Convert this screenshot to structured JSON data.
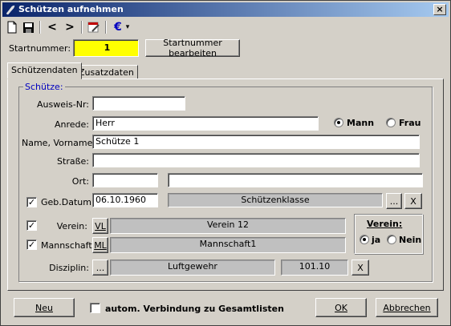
{
  "window": {
    "title": "Schützen aufnehmen",
    "close_label": "×"
  },
  "toolbar": {
    "prev_label": "<",
    "next_label": ">",
    "euro_label": "€",
    "dropdown_label": "▾"
  },
  "startnummer": {
    "label": "Startnummer:",
    "value": "1",
    "edit_button": "Startnummer bearbeiten",
    "highlight_color": "#ffff00"
  },
  "tabs": [
    {
      "label": "Schützendaten"
    },
    {
      "label": "Zusatzdaten"
    }
  ],
  "group": {
    "title": "Schütze:"
  },
  "fields": {
    "ausweis": {
      "label": "Ausweis-Nr:",
      "value": ""
    },
    "anrede": {
      "label": "Anrede:",
      "value": "Herr"
    },
    "gender": {
      "mann": "Mann",
      "frau": "Frau",
      "selected": "Mann"
    },
    "name": {
      "label": "Name, Vorname:",
      "value": "Schütze  1"
    },
    "strasse": {
      "label": "Straße:",
      "value": ""
    },
    "ort": {
      "label": "Ort:",
      "plz": "",
      "city": ""
    },
    "geb": {
      "label": "Geb.Datum:",
      "value": "06.10.1960",
      "checked": true,
      "klasse": "Schützenklasse",
      "dots": "...",
      "x": "X"
    },
    "verein": {
      "label": "Verein:",
      "checked": true,
      "button": "VL",
      "value": "Verein 12"
    },
    "mannschaft": {
      "label": "Mannschaft:",
      "checked": true,
      "button": "ML",
      "value": "Mannschaft1"
    },
    "disziplin": {
      "label": "Disziplin:",
      "dots": "...",
      "value": "Luftgewehr",
      "score": "101.10",
      "x": "X"
    }
  },
  "verein_box": {
    "title": "Verein:",
    "ja": "ja",
    "nein": "Nein",
    "selected": "ja"
  },
  "footer": {
    "neu": "Neu",
    "auto_label": "autom. Verbindung zu Gesamtlisten",
    "ok": "OK",
    "abbrechen": "Abbrechen"
  }
}
